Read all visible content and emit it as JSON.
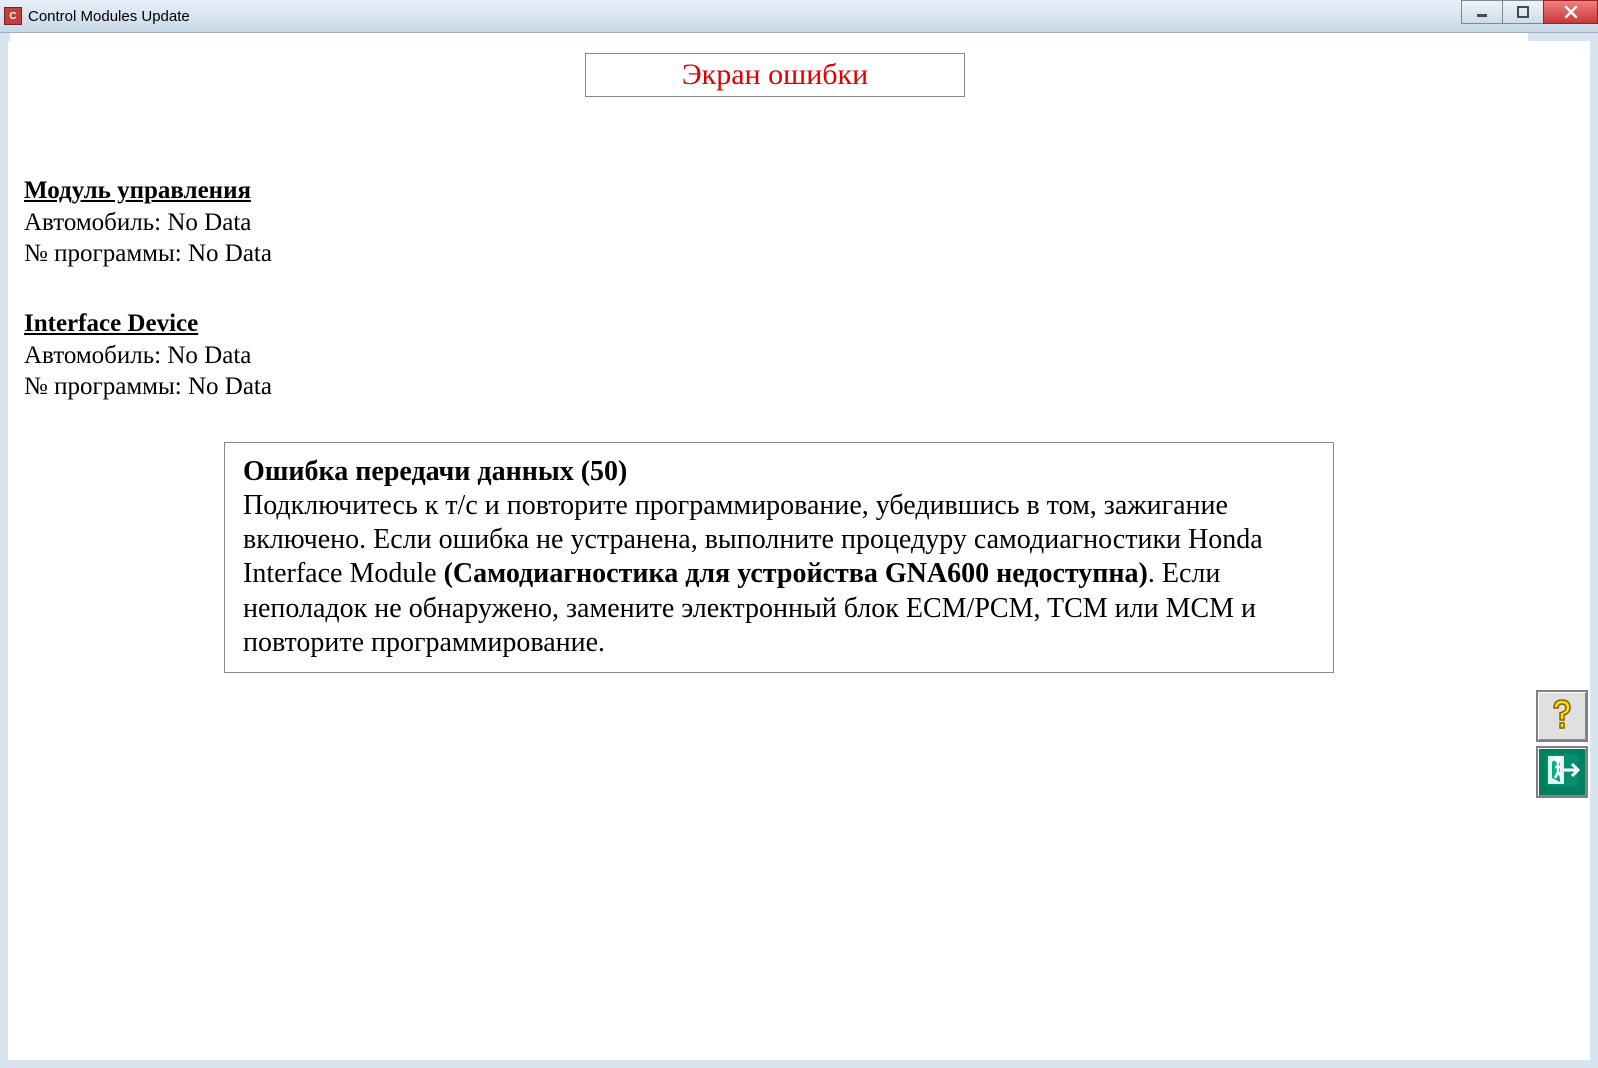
{
  "window": {
    "title": "Control Modules Update"
  },
  "heading": "Экран ошибки",
  "module": {
    "heading": "Модуль управления",
    "vehicle_label": "Автомобиль:",
    "vehicle_value": "No Data",
    "program_label": "№ программы:",
    "program_value": "No Data"
  },
  "interface": {
    "heading": "Interface Device",
    "vehicle_label": "Автомобиль:",
    "vehicle_value": "No Data",
    "program_label": "№ программы:",
    "program_value": "No Data"
  },
  "error": {
    "title": "Ошибка передачи данных (50)",
    "body_before": "Подключитесь к т/с и повторите программирование, убедившись в том, зажигание включено. Если ошибка не устранена, выполните процедуру самодиагностики Honda Interface Module ",
    "body_bold": "(Самодиагностика для устройства GNA600 недоступна)",
    "body_after": ". Если неполадок не обнаружено, замените электронный блок ECM/PCM, TCM или MCM и повторите программирование."
  }
}
